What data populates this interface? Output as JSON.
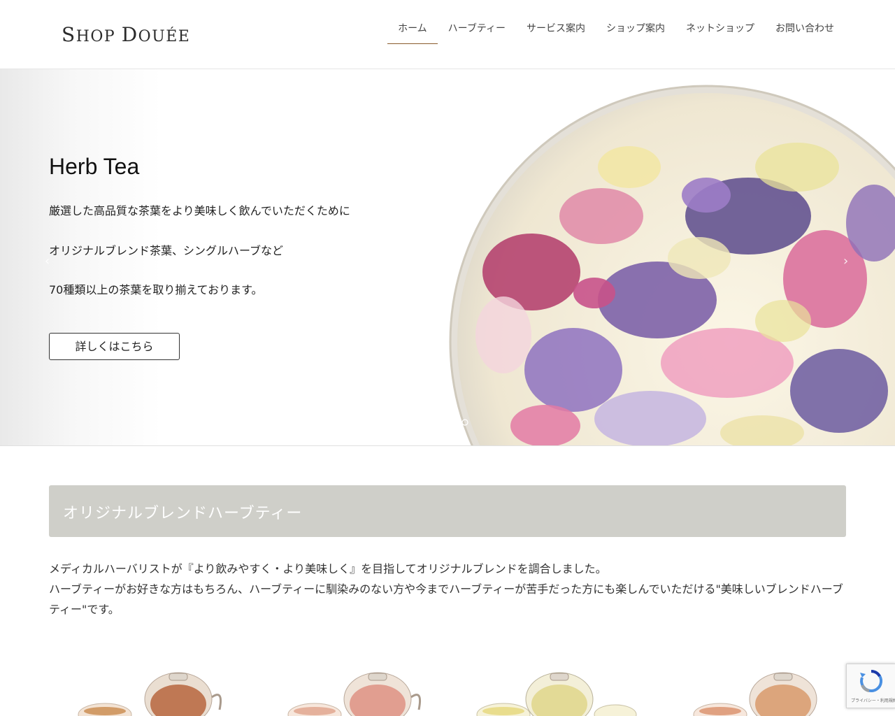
{
  "header": {
    "logo": "Shop Douée",
    "nav": [
      "ホーム",
      "ハーブティー",
      "サービス案内",
      "ショップ案内",
      "ネットショップ",
      "お問い合わせ"
    ],
    "active_index": 0,
    "accent_color": "#8a5a2c"
  },
  "hero": {
    "title": "Herb Tea",
    "lines": [
      "厳選した高品質な茶葉をより美味しく飲んでいただくために",
      "オリジナルブレンド茶葉、シングルハーブなど",
      "70種類以上の茶葉を取り揃えております。"
    ],
    "button_label": "詳しくはこちら",
    "prev_icon": "chevron-left-icon",
    "next_icon": "chevron-right-icon"
  },
  "section": {
    "heading": "オリジナルブレンドハーブティー",
    "heading_bg": "#cfcfc9",
    "description": [
      "メディカルハーバリストが『より飲みやすく・より美味しく』を目指してオリジナルブレンドを調合しました。",
      "ハーブティーがお好きな方はもちろん、ハーブティーに馴染みのない方や今までハーブティーが苦手だった方にも楽しんでいただける\"美味しいブレンドハーブティー\"です。"
    ]
  },
  "recaptcha": {
    "text": "プライバシー・利用規約"
  }
}
